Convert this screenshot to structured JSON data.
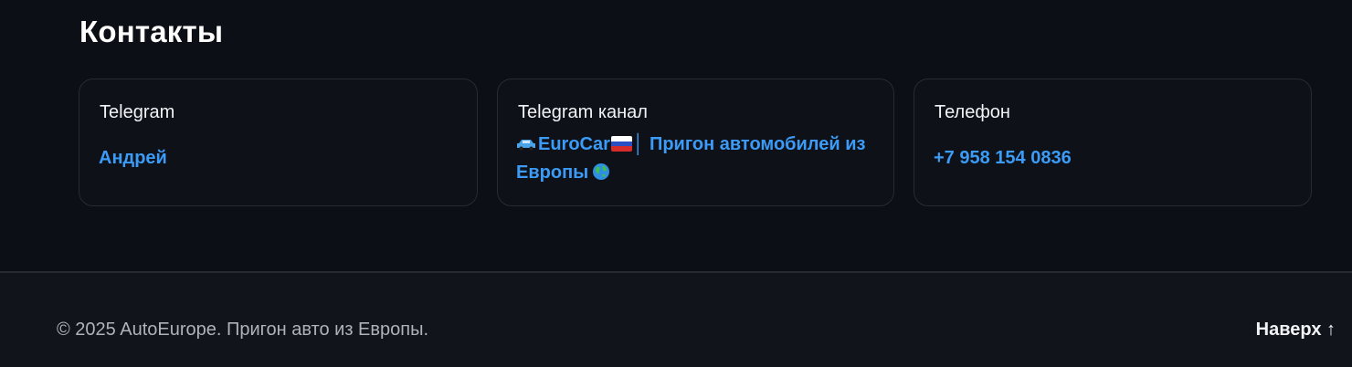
{
  "contacts": {
    "title": "Контакты",
    "cards": [
      {
        "label": "Telegram",
        "link": "Андрей"
      },
      {
        "label": "Telegram канал",
        "link_prefix": "EuroCar",
        "link_rest": "│ Пригон автомобилей из Европы"
      },
      {
        "label": "Телефон",
        "link": "+7 958 154 0836"
      }
    ]
  },
  "icons": {
    "car": "car-emoji",
    "flag": "russia-flag-emoji",
    "globe": "globe-emoji"
  },
  "footer": {
    "copyright": "© 2025 AutoEurope. Пригон авто из Европы.",
    "to_top": "Наверх ↑"
  },
  "colors": {
    "background": "#0c0f15",
    "footer_bg": "#11141a",
    "card_border": "#262b35",
    "link": "#3b9bf6",
    "muted_text": "#aeb3bb"
  }
}
